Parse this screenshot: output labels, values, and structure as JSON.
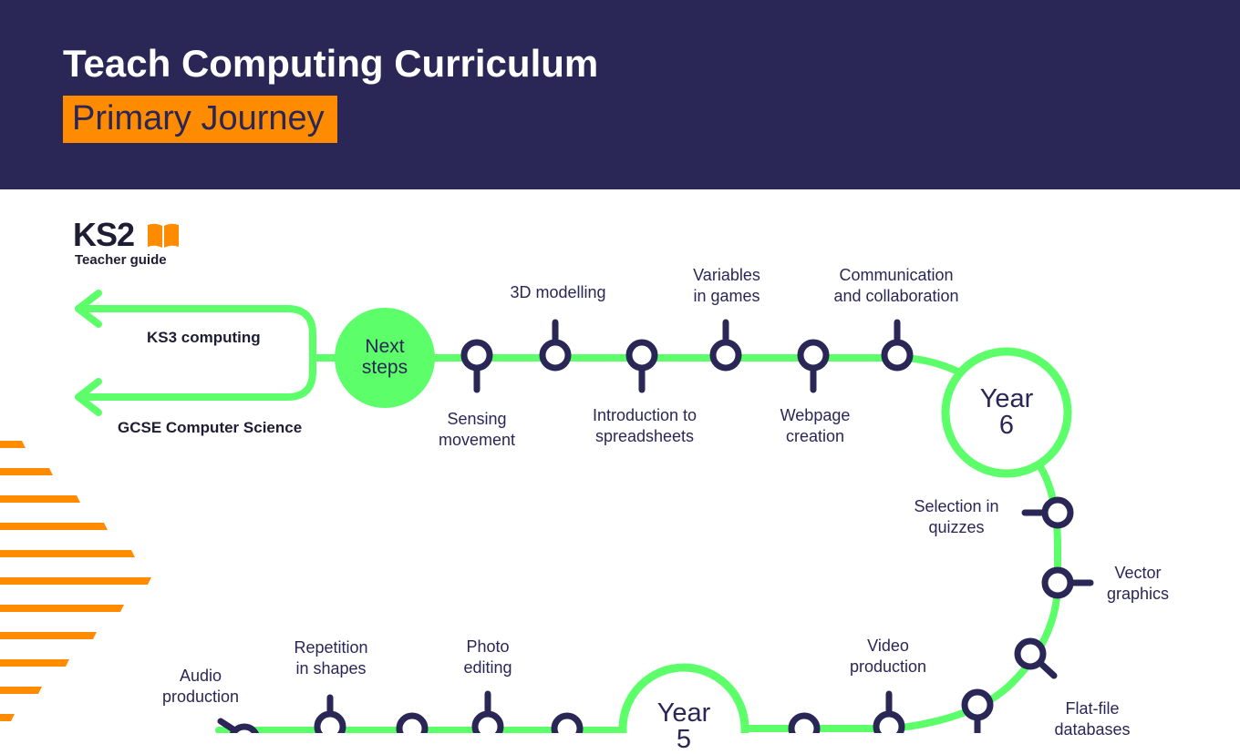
{
  "header": {
    "title": "Teach Computing Curriculum",
    "subtitle": "Primary Journey"
  },
  "badge": {
    "stage": "KS2",
    "guide": "Teacher guide",
    "icon": "open-book-icon"
  },
  "destinations": {
    "top": "KS3 computing",
    "bottom": "GCSE Computer Science"
  },
  "hubs": {
    "next_steps": "Next\nsteps",
    "year6": "Year\n6",
    "year5": "Year\n5"
  },
  "stations": {
    "sensing_movement": "Sensing\nmovement",
    "modelling_3d": "3D modelling",
    "intro_spreadsheets": "Introduction to\nspreadsheets",
    "variables_games": "Variables\nin games",
    "webpage_creation": "Webpage\ncreation",
    "communication": "Communication\nand collaboration",
    "selection_quizzes": "Selection in\nquizzes",
    "vector_graphics": "Vector\ngraphics",
    "flat_file_databases": "Flat-file\ndatabases",
    "video_production": "Video\nproduction",
    "photo_editing": "Photo\nediting",
    "repetition_shapes": "Repetition\nin shapes",
    "audio_production": "Audio\nproduction"
  },
  "colors": {
    "header_bg": "#2a2656",
    "accent_orange": "#ff8c00",
    "line_green": "#5cff6a",
    "station_navy": "#2a2656"
  }
}
